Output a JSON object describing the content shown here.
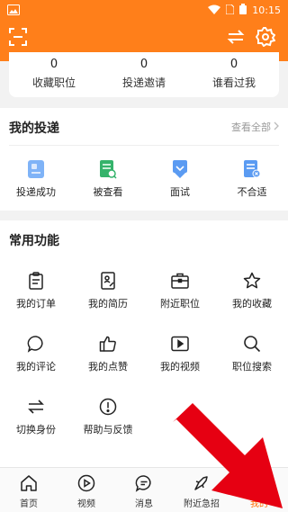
{
  "status_bar": {
    "time": "10:15"
  },
  "stats": [
    {
      "value": "0",
      "label": "收藏职位"
    },
    {
      "value": "0",
      "label": "投递邀请"
    },
    {
      "value": "0",
      "label": "谁看过我"
    }
  ],
  "delivery": {
    "title": "我的投递",
    "view_all": "查看全部",
    "items": [
      {
        "label": "投递成功",
        "icon": "resume-success-icon",
        "color": "#5b9bf2"
      },
      {
        "label": "被查看",
        "icon": "viewed-doc-icon",
        "color": "#35b36b"
      },
      {
        "label": "面试",
        "icon": "interview-pin-icon",
        "color": "#5b9bf2"
      },
      {
        "label": "不合适",
        "icon": "unsuitable-doc-icon",
        "color": "#5b9bf2"
      }
    ]
  },
  "common": {
    "title": "常用功能",
    "items": [
      {
        "label": "我的订单",
        "icon": "clipboard-icon"
      },
      {
        "label": "我的简历",
        "icon": "resume-icon"
      },
      {
        "label": "附近职位",
        "icon": "briefcase-icon"
      },
      {
        "label": "我的收藏",
        "icon": "star-icon"
      },
      {
        "label": "我的评论",
        "icon": "comment-icon"
      },
      {
        "label": "我的点赞",
        "icon": "thumbs-up-icon"
      },
      {
        "label": "我的视频",
        "icon": "video-icon"
      },
      {
        "label": "职位搜索",
        "icon": "search-icon"
      },
      {
        "label": "切换身份",
        "icon": "switch-icon"
      },
      {
        "label": "帮助与反馈",
        "icon": "help-icon"
      }
    ]
  },
  "bottom_nav": [
    {
      "label": "首页",
      "icon": "home-icon"
    },
    {
      "label": "视频",
      "icon": "play-icon"
    },
    {
      "label": "消息",
      "icon": "message-icon"
    },
    {
      "label": "附近急招",
      "icon": "urgent-icon"
    },
    {
      "label": "我的",
      "icon": "profile-icon"
    }
  ],
  "colors": {
    "brand": "#ff7f1a",
    "active": "#ff6a00",
    "arrow": "#e60012"
  }
}
